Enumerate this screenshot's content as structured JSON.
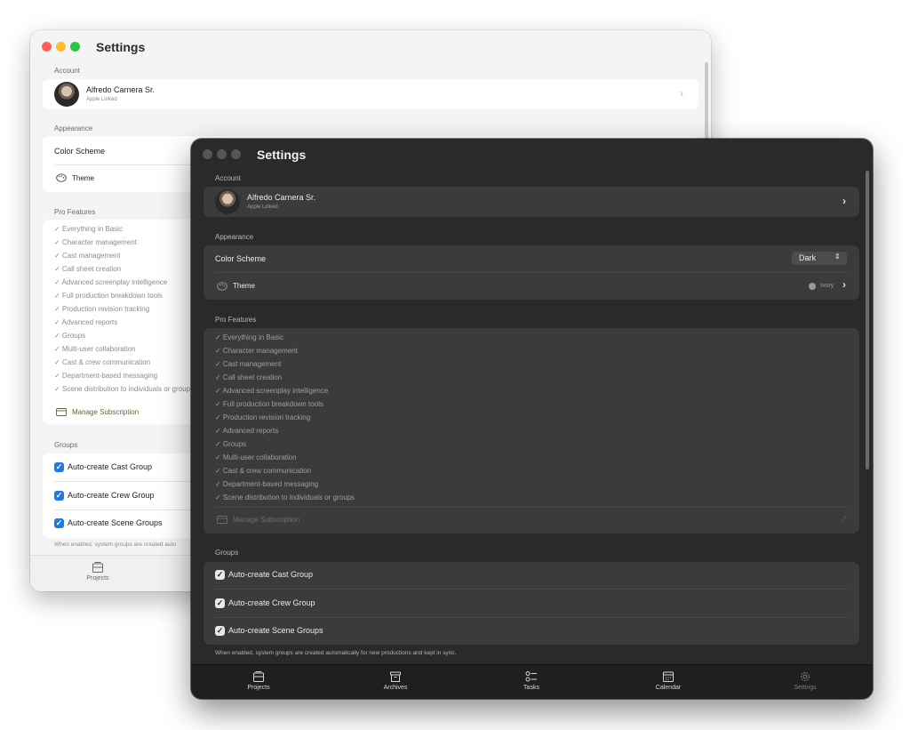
{
  "light_window": {
    "title": "Settings",
    "account_section": "Account",
    "user_name": "Alfredo Carnera Sr.",
    "user_sub": "Apple Linked",
    "appearance_section": "Appearance",
    "color_scheme_label": "Color Scheme",
    "theme_label": "Theme",
    "pro_section": "Pro Features",
    "features": [
      "✓ Everything in Basic",
      "✓ Character management",
      "✓ Cast management",
      "✓ Call sheet creation",
      "✓ Advanced screenplay intelligence",
      "✓ Full production breakdown tools",
      "✓ Production revision tracking",
      "✓ Advanced reports",
      "✓ Groups",
      "✓ Multi-user collaboration",
      "✓ Cast & crew communication",
      "✓ Department-based messaging",
      "✓ Scene distribution to individuals or group"
    ],
    "manage_subscription": "Manage Subscription",
    "groups_section": "Groups",
    "groups": [
      "Auto-create Cast Group",
      "Auto-create Crew Group",
      "Auto-create Scene Groups"
    ],
    "groups_note": "When enabled, system groups are created auto",
    "tab_projects": "Projects"
  },
  "dark_window": {
    "title": "Settings",
    "account_section": "Account",
    "user_name": "Alfredo Carnera Sr.",
    "user_sub": "Apple Linked",
    "appearance_section": "Appearance",
    "color_scheme_label": "Color Scheme",
    "color_scheme_value": "Dark",
    "theme_label": "Theme",
    "theme_value": "Ivory",
    "pro_section": "Pro Features",
    "features": [
      "✓ Everything in Basic",
      "✓ Character management",
      "✓ Cast management",
      "✓ Call sheet creation",
      "✓ Advanced screenplay intelligence",
      "✓ Full production breakdown tools",
      "✓ Production revision tracking",
      "✓ Advanced reports",
      "✓ Groups",
      "✓ Multi-user collaboration",
      "✓ Cast & crew communication",
      "✓ Department-based messaging",
      "✓ Scene distribution to individuals or groups"
    ],
    "manage_subscription": "Manage Subscription",
    "groups_section": "Groups",
    "groups": [
      "Auto-create Cast Group",
      "Auto-create Crew Group",
      "Auto-create Scene Groups"
    ],
    "groups_note": "When enabled, system groups are created automatically for new productions and kept in sync.",
    "tabs": [
      "Projects",
      "Archives",
      "Tasks",
      "Calendar",
      "Settings"
    ]
  },
  "colors": {
    "close": "#fe5f57",
    "minimize": "#febc2e",
    "zoom": "#28c840",
    "light_accent": "#1a7ae8",
    "manage_sub_light": "#5b6b2c"
  }
}
